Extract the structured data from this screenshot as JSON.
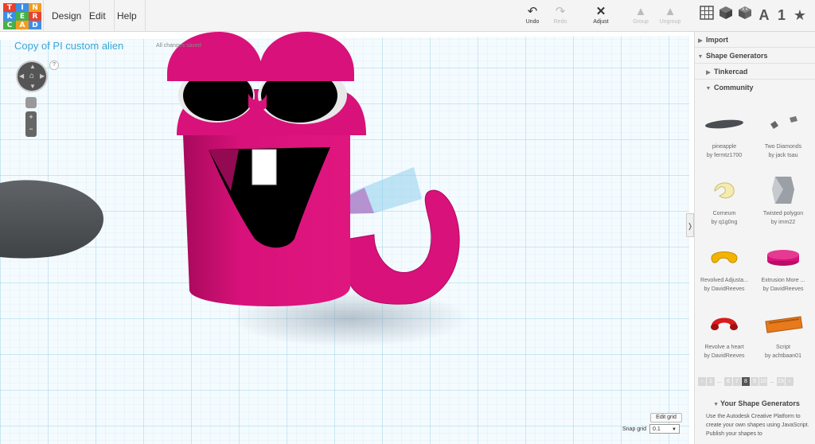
{
  "logo": {
    "letters": [
      "T",
      "I",
      "N",
      "K",
      "E",
      "R",
      "C",
      "A",
      "D"
    ],
    "colors": [
      "#e8412c",
      "#3b8ee8",
      "#f29c1f",
      "#3b8ee8",
      "#46b04a",
      "#e8412c",
      "#46b04a",
      "#f29c1f",
      "#3b8ee8"
    ]
  },
  "menu": {
    "design": "Design",
    "edit": "Edit",
    "help": "Help"
  },
  "toolbar": {
    "undo": "Undo",
    "redo": "Redo",
    "adjust": "Adjust",
    "group": "Group",
    "ungroup": "Ungroup"
  },
  "right_icons": {
    "grid": "grid-icon",
    "box": "box-icon",
    "brick": "brick-icon",
    "letter": "A",
    "number": "1",
    "star": "★"
  },
  "viewport": {
    "title": "Copy of PI custom alien",
    "saved": "All changes saved",
    "help": "?"
  },
  "grid_controls": {
    "edit_grid": "Edit grid",
    "snap_label": "Snap grid",
    "snap_value": "0.1"
  },
  "panel": {
    "import": "Import",
    "shape_generators": "Shape Generators",
    "tinkercad": "Tinkercad",
    "community": "Community",
    "items": [
      {
        "name": "pineapple",
        "author": "by fermtz1700"
      },
      {
        "name": "Two Diamonds",
        "author": "by jack tsau"
      },
      {
        "name": "Corneum",
        "author": "by q1g0ng"
      },
      {
        "name": "Twisted polygon",
        "author": "by imm22"
      },
      {
        "name": "Revolved Adjusta...",
        "author": "by DavidReeves"
      },
      {
        "name": "Extrusion More ...",
        "author": "by DavidReeves"
      },
      {
        "name": "Revolve a heart",
        "author": "by DavidReeves"
      },
      {
        "name": "Script",
        "author": "by achtbaan01"
      }
    ],
    "pager": [
      "1",
      "...",
      "6",
      "7",
      "8",
      "9",
      "10",
      "...",
      "23"
    ],
    "pager_current": "8",
    "your_generators": "Your Shape Generators",
    "your_text": "Use the Autodesk Creative Platform to create your own shapes using JavaScript. Publish your shapes to"
  },
  "colors": {
    "accent": "#3aa6d6",
    "magenta": "#d8127a",
    "grid": "#b9e0ee"
  }
}
